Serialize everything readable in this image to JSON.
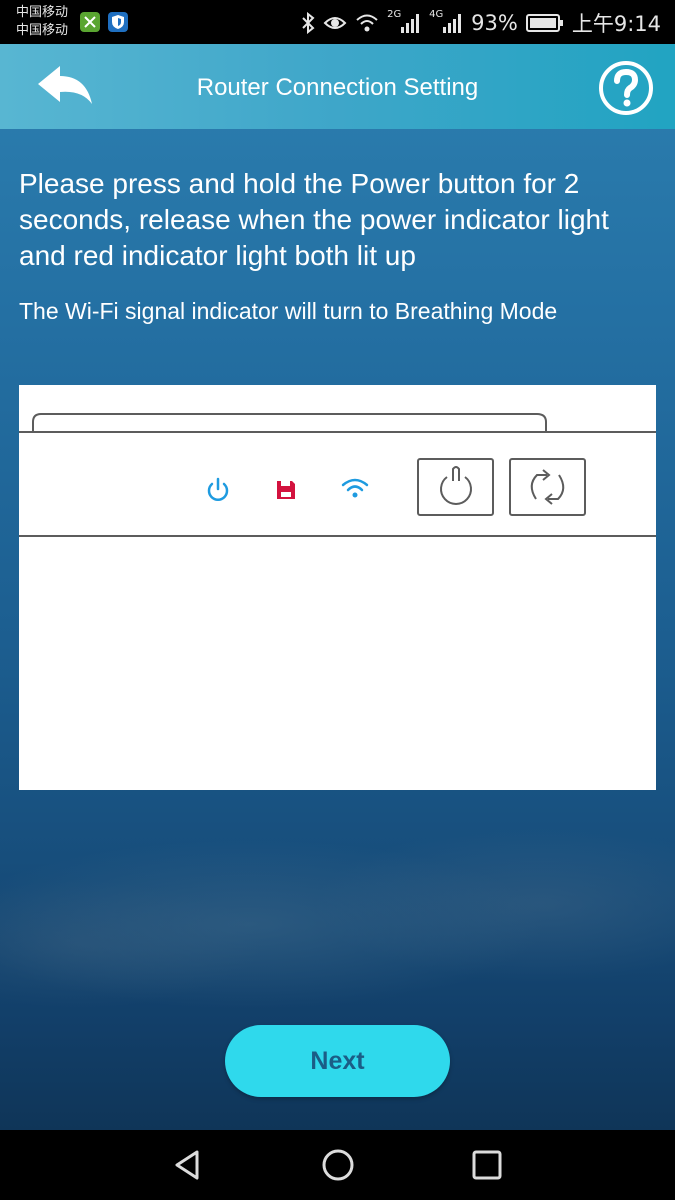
{
  "status_bar": {
    "carrier_1": "中国移动",
    "carrier_2": "中国移动",
    "network_2g": "2G",
    "network_4g": "4G",
    "battery": "93%",
    "time": "上午9:14",
    "icons": [
      "app-green-icon",
      "app-shield-icon",
      "bluetooth-icon",
      "eye-icon",
      "wifi-icon",
      "signal-2g-icon",
      "signal-4g-icon",
      "battery-icon"
    ]
  },
  "header": {
    "title": "Router Connection Setting",
    "back_icon": "back-arrow-icon",
    "help_icon": "help-icon"
  },
  "content": {
    "instruction": "Please press and hold the Power button for 2 seconds, release when the power indicator light and red indicator light both lit up",
    "note": "The Wi-Fi signal indicator will turn to Breathing Mode"
  },
  "router": {
    "indicators": [
      {
        "name": "power-indicator-icon",
        "color": "#1e9be0"
      },
      {
        "name": "storage-indicator-icon",
        "color": "#d3123e"
      },
      {
        "name": "wifi-indicator-icon",
        "color": "#1e9be0"
      }
    ],
    "buttons": [
      "power-button-icon",
      "reset-button-icon"
    ]
  },
  "footer": {
    "next_label": "Next"
  },
  "navbar": {
    "icons": [
      "back-nav-icon",
      "home-nav-icon",
      "recents-nav-icon"
    ]
  },
  "colors": {
    "header_accent": "#3ea6c9",
    "next_button": "#2fd9ec",
    "next_text": "#1b5d86"
  }
}
